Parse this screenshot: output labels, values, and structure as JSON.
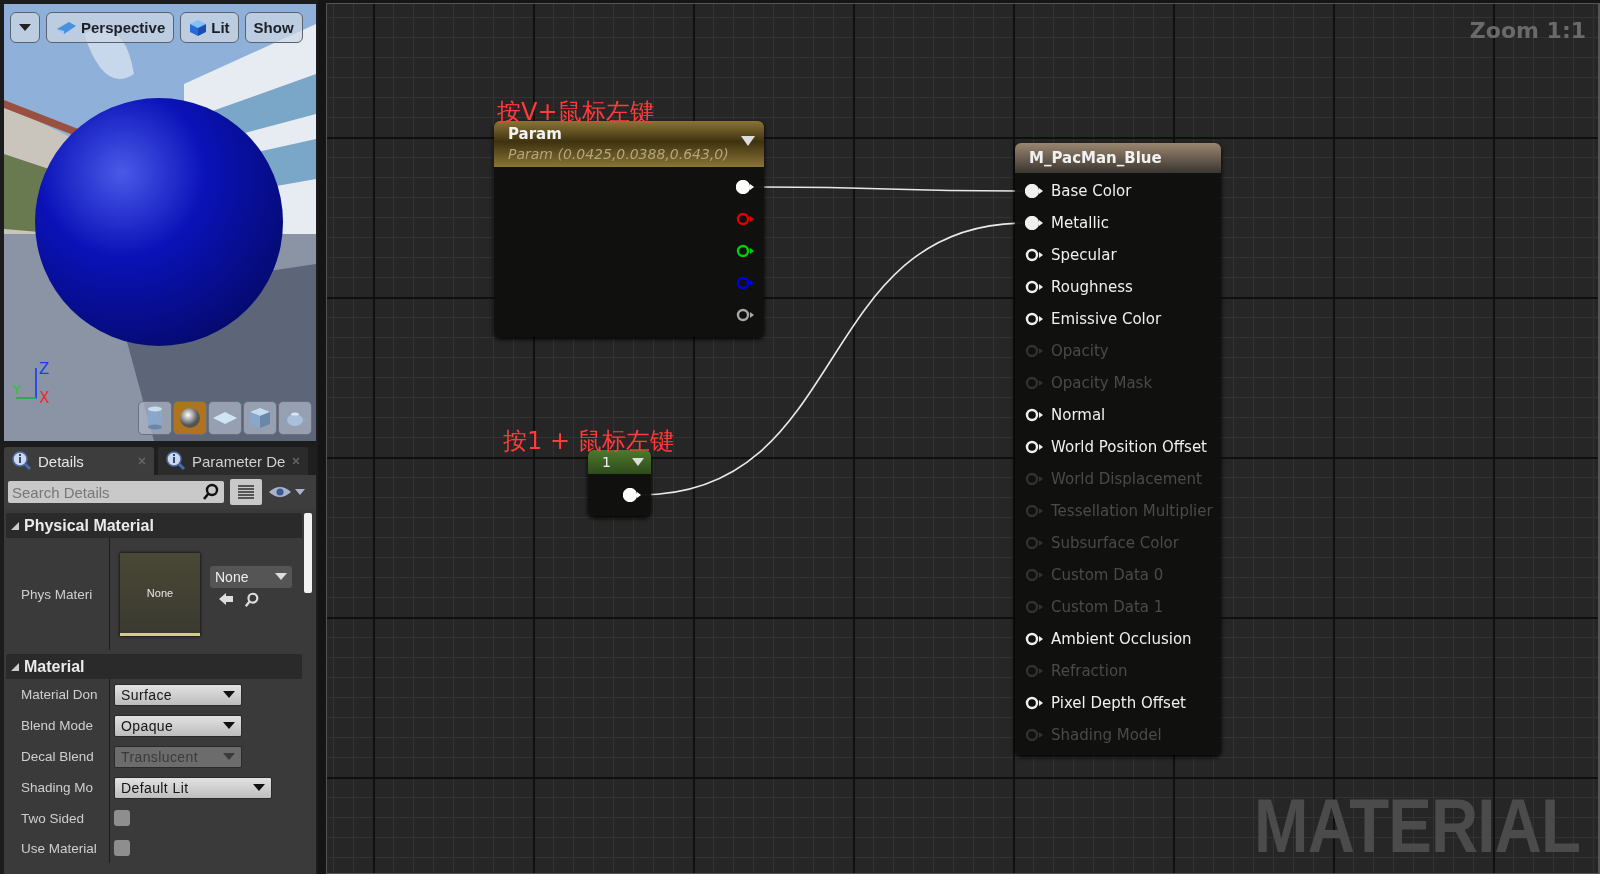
{
  "viewport": {
    "toolbar": [
      {
        "kind": "caret"
      },
      {
        "kind": "perspective",
        "label": "Perspective"
      },
      {
        "kind": "lit",
        "label": "Lit"
      },
      {
        "kind": "plain",
        "label": "Show"
      }
    ],
    "axes": {
      "z": "Z",
      "y": "Y",
      "x": "X"
    },
    "preview_shapes": [
      {
        "kind": "cylinder",
        "selected": false
      },
      {
        "kind": "sphere",
        "selected": true
      },
      {
        "kind": "plane",
        "selected": false
      },
      {
        "kind": "cube",
        "selected": false
      },
      {
        "kind": "teapot",
        "selected": false
      }
    ]
  },
  "details": {
    "tabs": [
      {
        "label": "Details",
        "selected": true
      },
      {
        "label": "Parameter De",
        "selected": false
      }
    ],
    "search": {
      "placeholder": "Search Details"
    },
    "sections": [
      {
        "title": "Physical Material",
        "expanded": true,
        "rows": [
          {
            "kind": "asset",
            "label": "Phys Materi",
            "thumbnail": "None",
            "value": "None"
          }
        ]
      },
      {
        "title": "Material",
        "expanded": true,
        "rows": [
          {
            "kind": "dropdown",
            "label": "Material Don",
            "value": "Surface",
            "disabled": false
          },
          {
            "kind": "dropdown",
            "label": "Blend Mode",
            "value": "Opaque",
            "disabled": false
          },
          {
            "kind": "dropdown",
            "label": "Decal Blend",
            "value": "Translucent",
            "disabled": true
          },
          {
            "kind": "dropdown",
            "label": "Shading Mo",
            "value": "Default Lit",
            "disabled": false
          },
          {
            "kind": "checkbox",
            "label": "Two Sided",
            "checked": false
          },
          {
            "kind": "checkbox",
            "label": "Use Material",
            "checked": false
          }
        ]
      }
    ]
  },
  "graph": {
    "zoom_label": "Zoom 1:1",
    "graph_type": "MATERIAL",
    "annotations": [
      "按V+鼠标左键",
      "按1 + 鼠标左键"
    ],
    "param_node": {
      "title": "Param",
      "subtitle": "Param (0.0425,0.0388,0.643,0)",
      "outputs": [
        {
          "color": "#ffffff",
          "connected": true
        },
        {
          "color": "#e00000",
          "connected": false
        },
        {
          "color": "#00d000",
          "connected": false
        },
        {
          "color": "#0000e0",
          "connected": false
        },
        {
          "color": "#a8a8a8",
          "connected": false
        }
      ]
    },
    "constant_node": {
      "value": "1",
      "outputs": [
        {
          "color": "#ffffff",
          "connected": true
        }
      ]
    },
    "material_node": {
      "title": "M_PacMan_Blue",
      "inputs": [
        {
          "label": "Base Color",
          "enabled": true,
          "connected": true
        },
        {
          "label": "Metallic",
          "enabled": true,
          "connected": true
        },
        {
          "label": "Specular",
          "enabled": true,
          "connected": false
        },
        {
          "label": "Roughness",
          "enabled": true,
          "connected": false
        },
        {
          "label": "Emissive Color",
          "enabled": true,
          "connected": false
        },
        {
          "label": "Opacity",
          "enabled": false,
          "connected": false
        },
        {
          "label": "Opacity Mask",
          "enabled": false,
          "connected": false
        },
        {
          "label": "Normal",
          "enabled": true,
          "connected": false
        },
        {
          "label": "World Position Offset",
          "enabled": true,
          "connected": false
        },
        {
          "label": "World Displacement",
          "enabled": false,
          "connected": false
        },
        {
          "label": "Tessellation Multiplier",
          "enabled": false,
          "connected": false
        },
        {
          "label": "Subsurface Color",
          "enabled": false,
          "connected": false
        },
        {
          "label": "Custom Data 0",
          "enabled": false,
          "connected": false
        },
        {
          "label": "Custom Data 1",
          "enabled": false,
          "connected": false
        },
        {
          "label": "Ambient Occlusion",
          "enabled": true,
          "connected": false
        },
        {
          "label": "Refraction",
          "enabled": false,
          "connected": false
        },
        {
          "label": "Pixel Depth Offset",
          "enabled": true,
          "connected": false
        },
        {
          "label": "Shading Model",
          "enabled": false,
          "connected": false
        }
      ]
    }
  }
}
